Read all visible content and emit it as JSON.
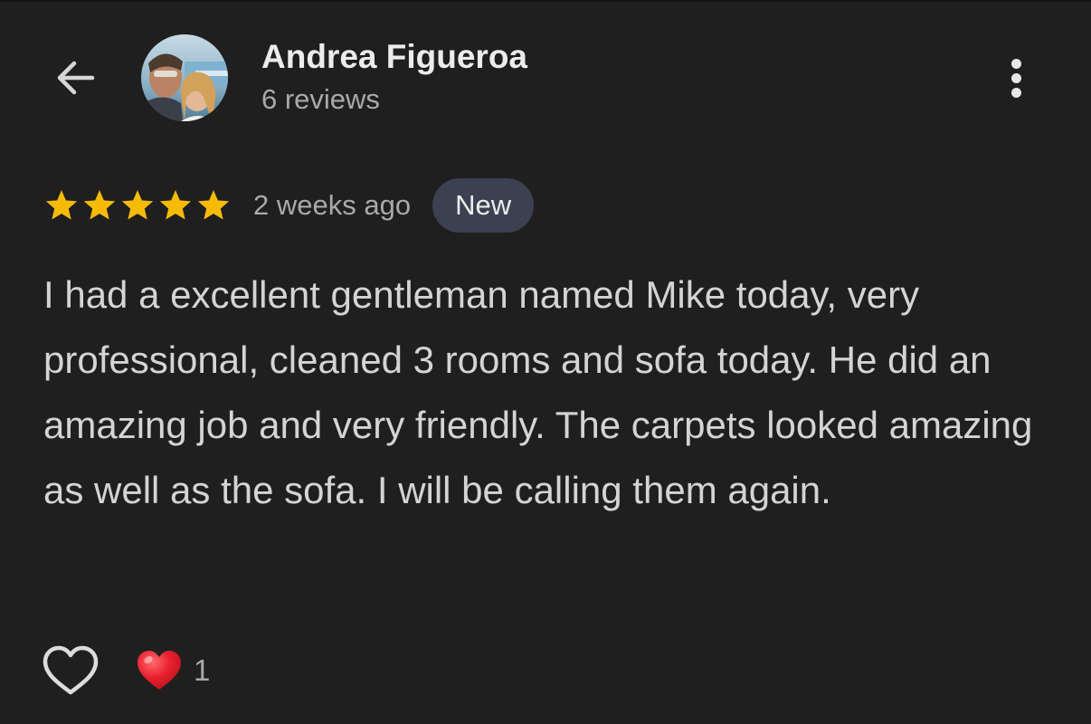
{
  "header": {
    "back_icon": "arrow-left-icon",
    "author_name": "Andrea Figueroa",
    "review_count": "6 reviews",
    "more_icon": "more-vertical-icon"
  },
  "review": {
    "rating": 5,
    "rating_max": 5,
    "star_color": "#f6bb06",
    "time_ago": "2 weeks ago",
    "badge": "New",
    "text": "I had a excellent gentleman named Mike today, very professional, cleaned 3 rooms and sofa today. He did an amazing job and very friendly. The carpets looked amazing as well as the sofa. I will be calling them again."
  },
  "actions": {
    "like_icon": "heart-outline-icon",
    "reaction_icon": "red-heart-icon",
    "reaction_count": "1"
  },
  "colors": {
    "background": "#1f1f1f",
    "badge_background": "#3b4150",
    "reaction_red": "#e8202e"
  }
}
